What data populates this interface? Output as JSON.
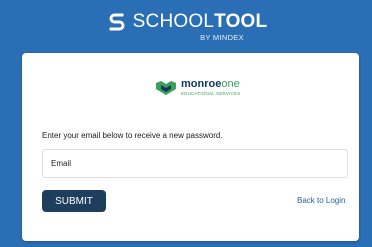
{
  "header": {
    "brand_prefix": "SCHOOL",
    "brand_bold": "TOOL",
    "brand_sub": "BY MINDEX"
  },
  "partner": {
    "name_part1": "monroe",
    "name_part2": "one",
    "subtitle": "EDUCATIONAL SERVICES"
  },
  "form": {
    "instruction": "Enter your email below to receive a new password.",
    "email_placeholder": "Email",
    "email_value": "",
    "submit_label": "SUBMIT",
    "back_link": "Back to Login"
  },
  "colors": {
    "background": "#2a6fb5",
    "button": "#1d3e5c",
    "link": "#1e63a8"
  },
  "icons": {
    "brand": "schooltool-s-logo-icon",
    "partner": "monroe-one-logo-icon"
  }
}
